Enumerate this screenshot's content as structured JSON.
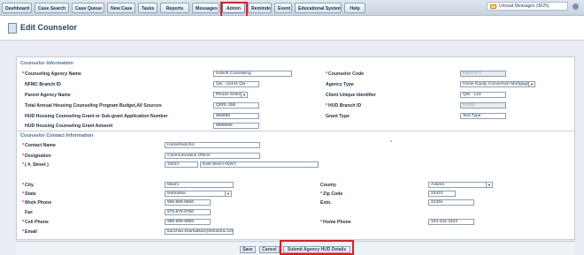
{
  "nav": {
    "tabs": [
      "Dashboard",
      "Case Search",
      "Case Queue",
      "New Case",
      "Tasks",
      "Reports",
      "Messages",
      "Admin",
      "Reminder",
      "Event",
      "Educational System",
      "Help"
    ],
    "messages": "Unread Messages (3625)"
  },
  "page": {
    "title": "Edit Counselor"
  },
  "counselor_info": {
    "header": "Counselor Information",
    "agency_name_label": "Counseling Agency Name",
    "agency_name_value": "Indsoft Counseling",
    "counselor_code_label": "Counselor Code",
    "counselor_code_value": "INDSOFT",
    "nfmc_label": "NFMC Branch ID",
    "nfmc_value": "Qw - 12444 Qw -",
    "agency_type_label": "Agency Type",
    "agency_type_value": "Home Equity Conversion Mortgage",
    "parent_agency_label": "Parent Agency Name",
    "parent_agency_value": "Please Select",
    "client_uid_label": "Client Unique Identifier",
    "client_uid_value": "QW - 123",
    "budget_label": "Total Annual Housing Counseling Program Budget,All Sources",
    "budget_value": "QERL 555",
    "hud_branch_label": "HUD Branch ID",
    "hud_branch_value": "81859",
    "grant_app_label": "HUD Housing Counseling Grant or Sub-grant Application Number",
    "grant_app_value": "888888",
    "grant_type_label": "Grant Type",
    "grant_type_value": "Test Type",
    "grant_amount_label": "HUD Housing Counseling Grant Amount",
    "grant_amount_value": "9999999"
  },
  "contact_info": {
    "header": "Counselor Contact Information",
    "contact_name_label": "Contact Name",
    "contact_name_value": "HomefreeUSA",
    "designation_label": "Designation",
    "designation_value": "Communication Officer",
    "street_label": "( #, Street )",
    "street_number": "3401A",
    "street_name": "East West HGWY",
    "city_label": "City",
    "city_value": "Miami",
    "county_label": "County",
    "county_value": "Adams",
    "state_label": "State",
    "state_value": "Nebraska",
    "zip_label": "Zip Code",
    "zip_value": "23423",
    "work_phone_label": "Work Phone",
    "work_phone_value": "666-666-6666",
    "extn_label": "Extn.",
    "extn_value": "21334",
    "fax_label": "Fax",
    "fax_value": "575-675-6756",
    "cell_phone_label": "Cell Phone",
    "cell_phone_value": "999-999-9999",
    "home_phone_label": "Home Phone",
    "home_phone_value": "344-242-3423",
    "email_label": "Email",
    "email_value": "kanchan.khartadkar@itshastra.com"
  },
  "footer": {
    "save": "Save",
    "cancel": "Cancel",
    "submit": "Submit Agency HUD Details"
  }
}
